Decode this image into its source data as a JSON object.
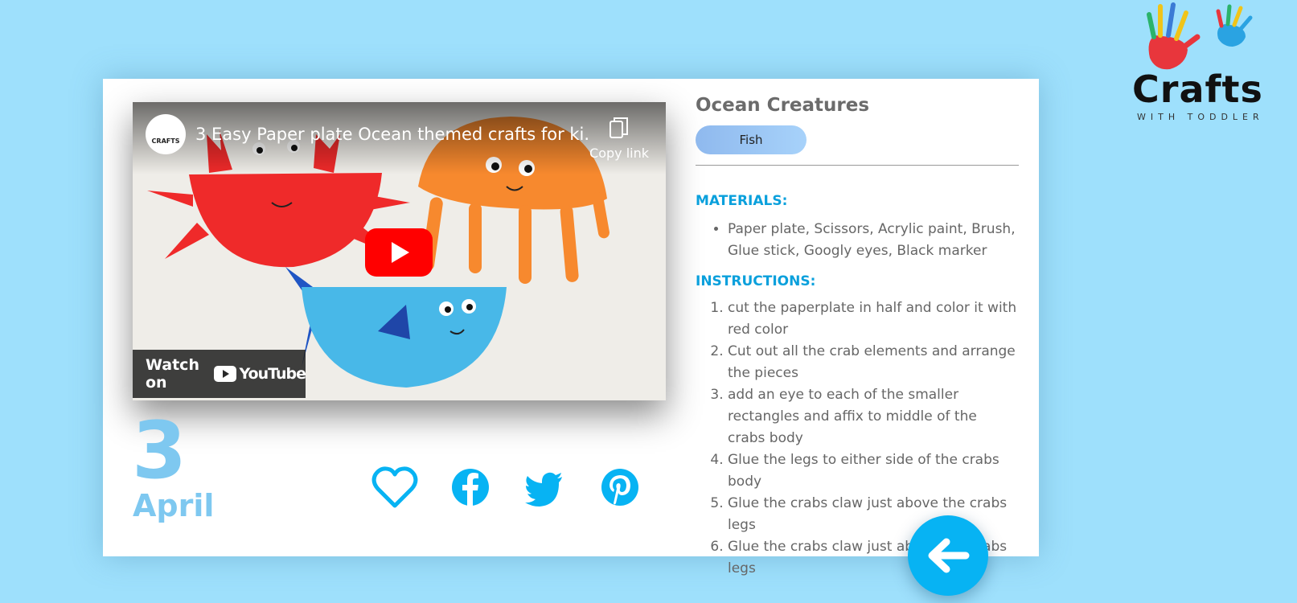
{
  "brand": {
    "name": "Crafts",
    "tagline": "WITH TODDLER"
  },
  "video": {
    "channel_avatar_text": "CRAFTS",
    "title": "3 Easy Paper plate Ocean themed crafts for ki...",
    "copy_link_label": "Copy link",
    "watch_on_label": "Watch on",
    "youtube_label": "YouTube"
  },
  "date": {
    "day": "3",
    "month": "April"
  },
  "share": {
    "icons": [
      "heart-icon",
      "facebook-icon",
      "twitter-icon",
      "pinterest-icon"
    ],
    "color": "#07b3f3"
  },
  "craft": {
    "title": "Ocean Creatures",
    "tag": "Fish",
    "materials_heading": "MATERIALS:",
    "materials": [
      "Paper plate, Scissors, Acrylic paint, Brush, Glue stick, Googly eyes, Black marker"
    ],
    "instructions_heading": "INSTRUCTIONS:",
    "instructions": [
      "cut the paperplate in half and color it with red color",
      "Cut out all the crab elements and arrange the pieces",
      "add an eye to each of the smaller rectangles and affix to middle of the crabs body",
      "Glue the legs to either side of the crabs body",
      "Glue the crabs claw just above the crabs legs",
      "Glue the crabs claw just above the crabs legs"
    ]
  },
  "navigation": {
    "back_icon": "arrow-left-icon"
  },
  "colors": {
    "page_background": "#9ee0fc",
    "accent": "#07b3f3",
    "date_color": "#7ec8f0",
    "heading_color": "#0aa0dc"
  }
}
